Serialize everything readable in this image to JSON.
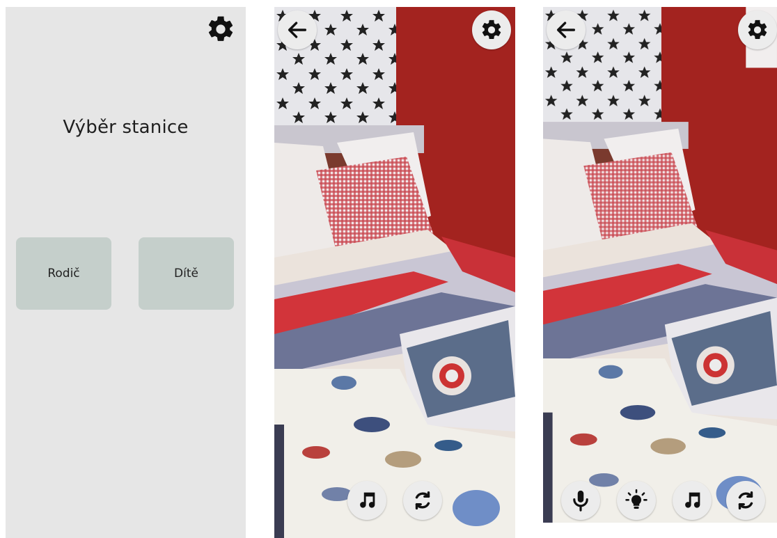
{
  "station_select": {
    "title": "Výběr stanice",
    "parent_label": "Rodič",
    "child_label": "Dítě"
  },
  "icons": {
    "settings": "gear-icon",
    "back": "arrow-left-icon",
    "music": "music-note-icon",
    "switch_camera": "camera-switch-icon",
    "microphone": "microphone-icon",
    "light": "light-bulb-icon"
  },
  "colors": {
    "screen_bg": "#e6e6e6",
    "button_bg": "#c5cfcb",
    "circle_button_bg": "#ececec"
  }
}
